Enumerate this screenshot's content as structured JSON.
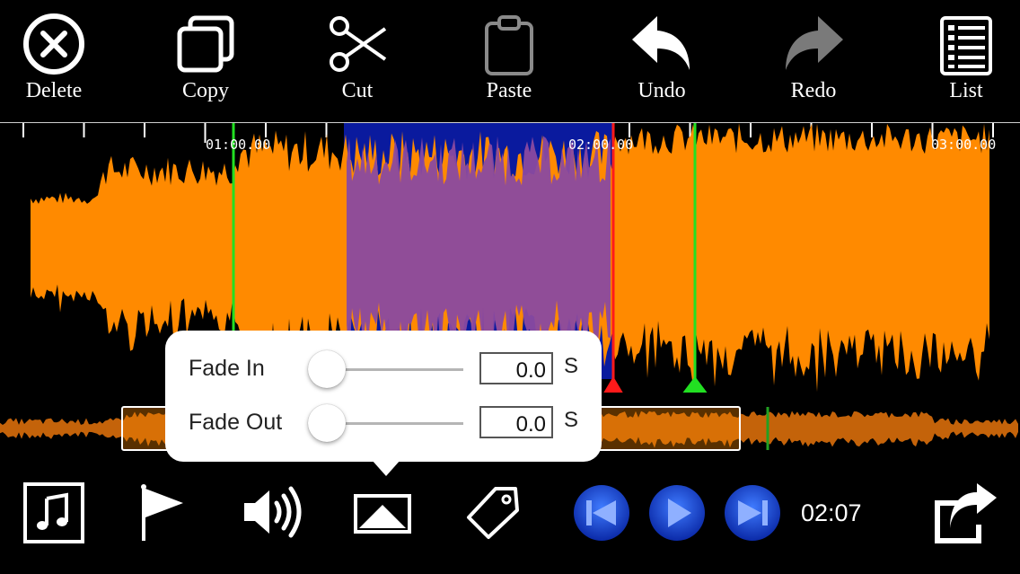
{
  "toolbar": {
    "delete_label": "Delete",
    "copy_label": "Copy",
    "cut_label": "Cut",
    "paste_label": "Paste",
    "undo_label": "Undo",
    "redo_label": "Redo",
    "list_label": "List"
  },
  "timeline": {
    "tick_labels": [
      "01:00.00",
      "02:00.00",
      "03:00.00"
    ]
  },
  "fade": {
    "fade_in_label": "Fade In",
    "fade_in_value": "0.0",
    "fade_in_unit": "S",
    "fade_in_level": 0,
    "fade_out_label": "Fade Out",
    "fade_out_value": "0.0",
    "fade_out_unit": "S",
    "fade_out_level": 0
  },
  "transport": {
    "current_time": "02:07"
  },
  "icons": {
    "music": "music-note-icon",
    "flag": "flag-icon",
    "volume": "volume-icon",
    "fade": "fade-icon",
    "tag": "tag-icon",
    "prev": "skip-back-icon",
    "play": "play-icon",
    "next": "skip-forward-icon",
    "share": "share-icon"
  },
  "colors": {
    "waveform": "#ff8a00",
    "selection": "#0a1a9e",
    "cursor": "#ff1a1a",
    "marker": "#22e022",
    "transport_blue": "#1e4fd6"
  }
}
